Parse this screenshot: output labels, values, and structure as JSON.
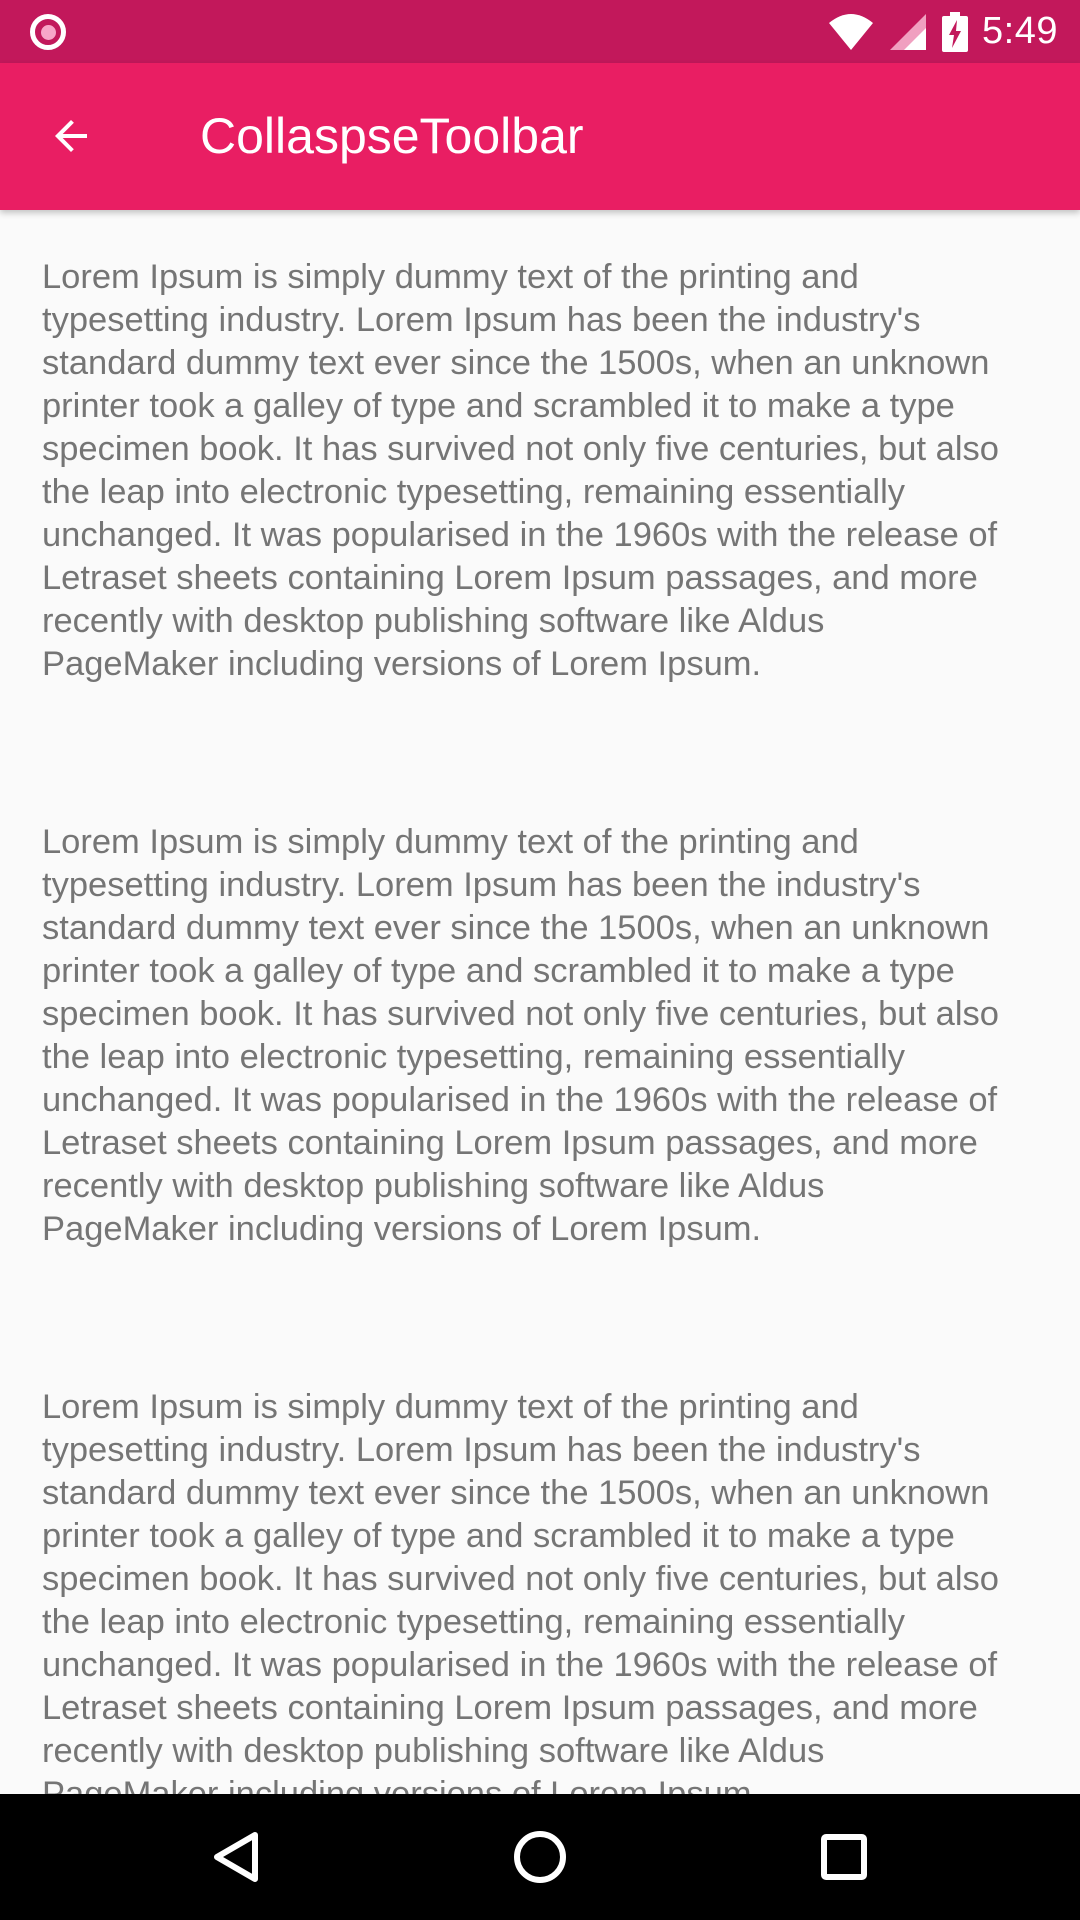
{
  "status_bar": {
    "time": "5:49",
    "icons": [
      "notification-icon",
      "wifi-icon",
      "signal-icon",
      "battery-charging-icon"
    ]
  },
  "app_bar": {
    "title": "CollaspseToolbar",
    "back_icon": "arrow-back-icon"
  },
  "content": {
    "paragraphs": [
      "Lorem Ipsum is simply dummy text of the printing and typesetting industry. Lorem Ipsum has been the industry's standard dummy text ever since the 1500s, when an unknown printer took a galley of type and scrambled it to make a type specimen book. It has survived not only five centuries, but also the leap into electronic typesetting, remaining essentially unchanged. It was popularised in the 1960s with the release of Letraset sheets containing Lorem Ipsum passages, and more recently with desktop publishing software like Aldus PageMaker including versions of Lorem Ipsum.",
      "Lorem Ipsum is simply dummy text of the printing and typesetting industry. Lorem Ipsum has been the industry's standard dummy text ever since the 1500s, when an unknown printer took a galley of type and scrambled it to make a type specimen book. It has survived not only five centuries, but also the leap into electronic typesetting, remaining essentially unchanged. It was popularised in the 1960s with the release of Letraset sheets containing Lorem Ipsum passages, and more recently with desktop publishing software like Aldus PageMaker including versions of Lorem Ipsum.",
      "Lorem Ipsum is simply dummy text of the printing and typesetting industry. Lorem Ipsum has been the industry's standard dummy text ever since the 1500s, when an unknown printer took a galley of type and scrambled it to make a type specimen book. It has survived not only five centuries, but also the leap into electronic typesetting, remaining essentially unchanged. It was popularised in the 1960s with the release of Letraset sheets containing Lorem Ipsum passages, and more recently with desktop publishing software like Aldus PageMaker including versions of Lorem Ipsum."
    ]
  },
  "nav_bar": {
    "icons": [
      "back-triangle-icon",
      "home-circle-icon",
      "recents-square-icon"
    ]
  },
  "colors": {
    "status_bar": "#c2185b",
    "app_bar": "#e91e63",
    "background": "#fafafa",
    "body_text": "#757575",
    "nav_bar": "#000000"
  }
}
